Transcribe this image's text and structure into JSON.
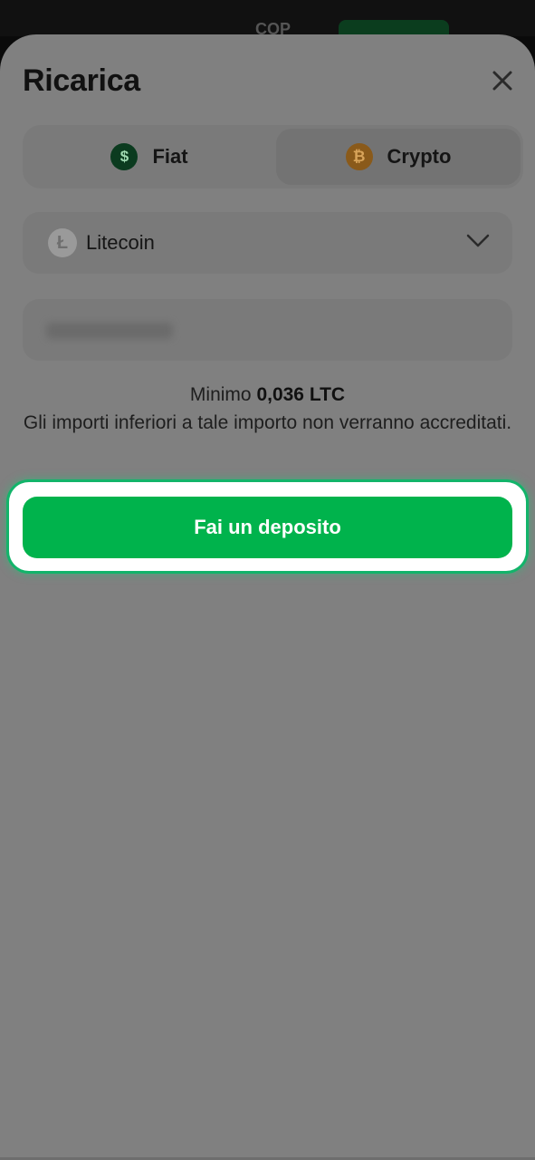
{
  "background": {
    "currency": "COP"
  },
  "header": {
    "title": "Ricarica",
    "close_icon": "close-icon"
  },
  "tabs": [
    {
      "label": "Fiat",
      "icon": "dollar-coin-icon",
      "selected": false
    },
    {
      "label": "Crypto",
      "icon": "bitcoin-coin-icon",
      "selected": true
    }
  ],
  "currency_select": {
    "value": "Litecoin",
    "icon": "litecoin-icon"
  },
  "info": {
    "min_prefix": "Minimo",
    "min_value": "0,036 LTC",
    "note": "Gli importi inferiori a tale importo non verranno accreditati."
  },
  "deposit_button": {
    "label": "Fai un deposito"
  },
  "colors": {
    "accent": "#00b34c",
    "overlay": "#808080",
    "highlight_ring": "#12b46a"
  }
}
